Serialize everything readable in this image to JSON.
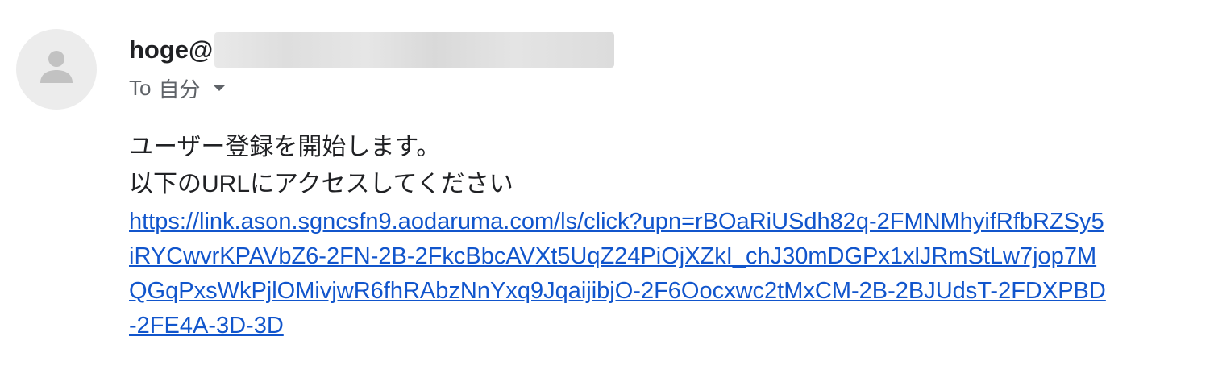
{
  "message": {
    "sender_visible": "hoge@",
    "to_prefix": "To",
    "to_recipient": "自分",
    "body_lines": [
      "ユーザー登録を開始します。",
      "以下のURLにアクセスしてください"
    ],
    "link_lines": [
      "https://link.ason.sgncsfn9.aodaruma.com/ls/click?upn=rBOaRiUSdh82q-2FMNMhyifRfbRZSy5",
      "iRYCwvrKPAVbZ6-2FN-2B-2FkcBbcAVXt5UqZ24PiOjXZkI_chJ30mDGPx1xlJRmStLw7jop7M",
      "QGqPxsWkPjlOMivjwR6fhRAbzNnYxq9JqaijibjO-2F6Oocxwc2tMxCM-2B-2BJUdsT-2FDXPBD",
      "-2FE4A-3D-3D"
    ]
  },
  "colors": {
    "link": "#1155cc",
    "sender_text": "#202124",
    "meta_text": "#5f6368",
    "avatar_bg": "#ececec",
    "avatar_icon": "#c2c2c2"
  },
  "icons": {
    "avatar": "person-icon",
    "recipient_details": "dropdown-arrow-icon"
  }
}
